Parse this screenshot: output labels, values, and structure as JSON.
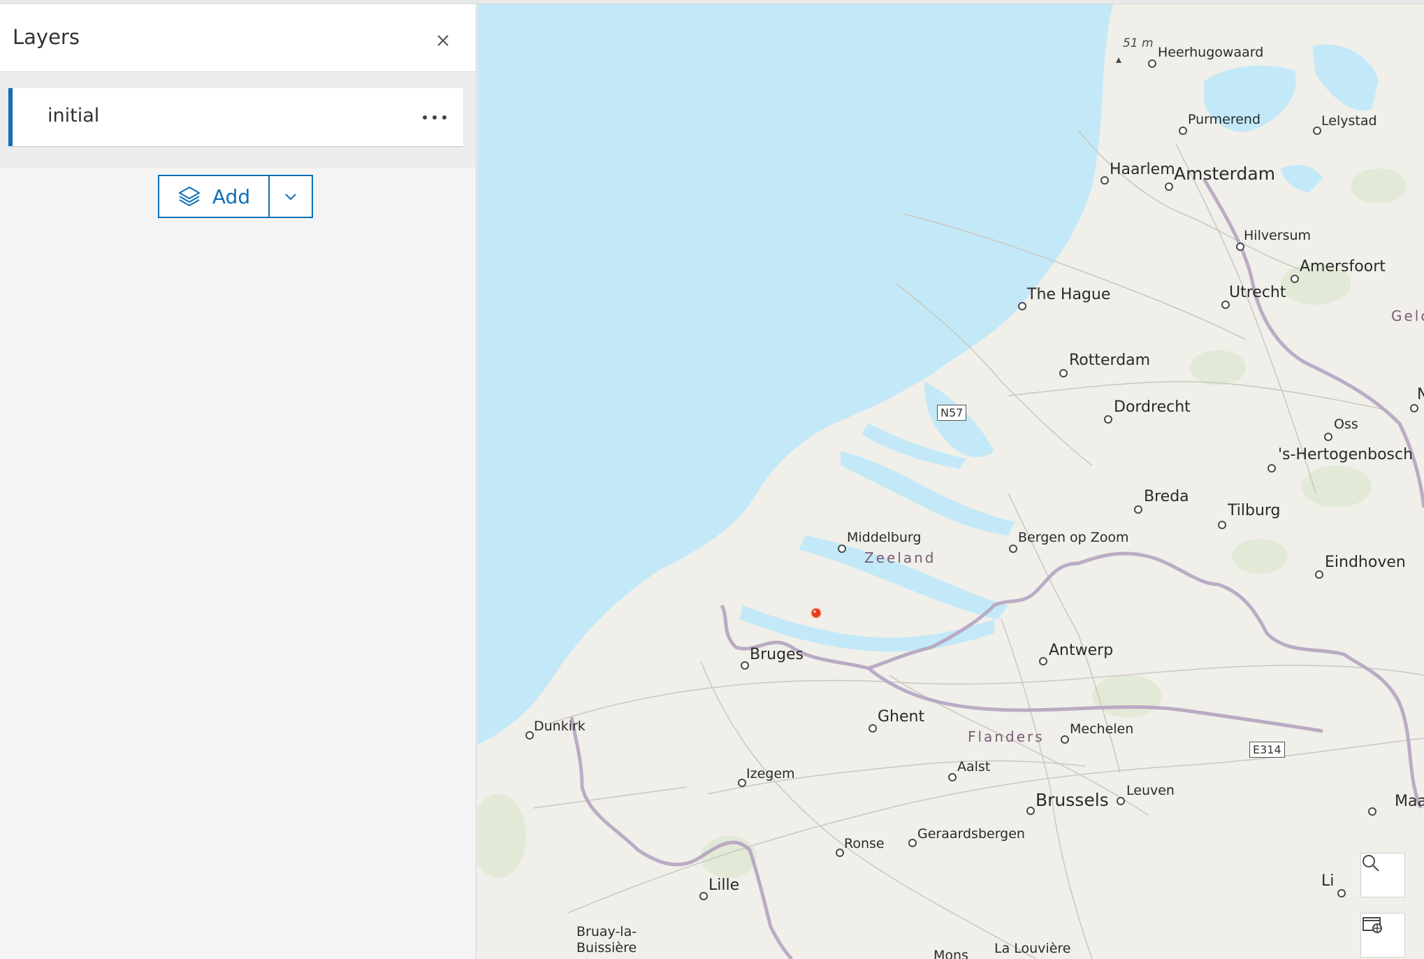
{
  "panel": {
    "title": "Layers",
    "close_icon": "close-icon",
    "layers": [
      {
        "name": "initial",
        "menu_icon": "more-horizontal-icon"
      }
    ],
    "add_button": {
      "label": "Add",
      "icon": "layers-icon",
      "split_icon": "chevron-down-icon"
    }
  },
  "map": {
    "ocean_color": "#c3e9f8",
    "land_color": "#f0efea",
    "marker_color": "#e63a1a",
    "places": {
      "heerhugowaard": "Heerhugowaard",
      "elevation": "51 m",
      "purmerend": "Purmerend",
      "lelystad": "Lelystad",
      "haarlem": "Haarlem",
      "amsterdam": "Amsterdam",
      "hilversum": "Hilversum",
      "amersfoort": "Amersfoort",
      "the_hague": "The Hague",
      "utrecht": "Utrecht",
      "gelderland": "Gelc",
      "rotterdam": "Rotterdam",
      "dordrecht": "Dordrecht",
      "oss": "Oss",
      "n_edge": "N",
      "hertogenbosch": "'s-Hertogenbosch",
      "breda": "Breda",
      "tilburg": "Tilburg",
      "middelburg": "Middelburg",
      "zeeland": "Zeeland",
      "bergen_op_zoom": "Bergen op Zoom",
      "eindhoven": "Eindhoven",
      "bruges": "Bruges",
      "antwerp": "Antwerp",
      "ghent": "Ghent",
      "flanders": "Flanders",
      "mechelen": "Mechelen",
      "dunkirk": "Dunkirk",
      "izegem": "Izegem",
      "aalst": "Aalst",
      "brussels": "Brussels",
      "leuven": "Leuven",
      "maastricht": "Maastr",
      "ronse": "Ronse",
      "geraardsbergen": "Geraardsbergen",
      "lille": "Lille",
      "liege": "Li",
      "bruay": "Bruay-la-",
      "buissiere": "Buissière",
      "mons": "Mons",
      "la_louviere": "La Louvière"
    },
    "shields": {
      "n57": "N57",
      "e314": "E314"
    },
    "controls": [
      {
        "icon": "search-icon"
      },
      {
        "icon": "basemap-gallery-icon"
      }
    ]
  }
}
